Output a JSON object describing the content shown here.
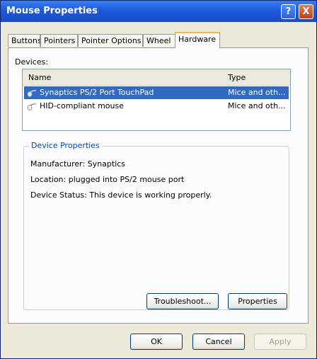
{
  "window": {
    "title": "Mouse Properties",
    "help_label": "?",
    "close_label": "X"
  },
  "tabs": [
    {
      "label": "Buttons"
    },
    {
      "label": "Pointers"
    },
    {
      "label": "Pointer Options"
    },
    {
      "label": "Wheel"
    },
    {
      "label": "Hardware"
    }
  ],
  "devices": {
    "label": "Devices:",
    "columns": {
      "name": "Name",
      "type": "Type"
    },
    "rows": [
      {
        "name": "Synaptics PS/2 Port TouchPad",
        "type": "Mice and oth...",
        "icon": "mouse-icon"
      },
      {
        "name": "HID-compliant mouse",
        "type": "Mice and oth...",
        "icon": "mouse-icon"
      }
    ]
  },
  "device_properties": {
    "legend": "Device Properties",
    "manufacturer": "Manufacturer: Synaptics",
    "location": "Location: plugged into PS/2 mouse port",
    "status": "Device Status: This device is working properly."
  },
  "buttons": {
    "troubleshoot": "Troubleshoot...",
    "properties": "Properties",
    "ok": "OK",
    "cancel": "Cancel",
    "apply": "Apply"
  },
  "colors": {
    "titlebar": "#1e5ad8",
    "selection": "#316ac5",
    "group_legend": "#0046d5"
  }
}
